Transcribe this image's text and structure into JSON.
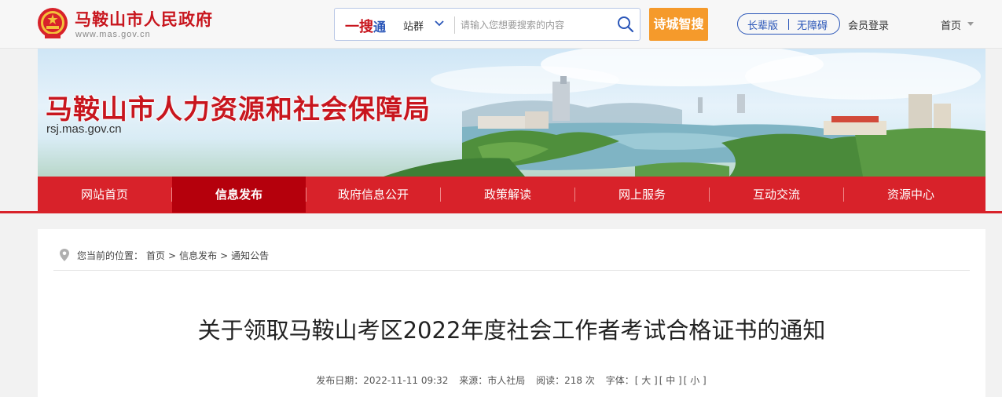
{
  "header": {
    "site_name": "马鞍山市人民政府",
    "site_url": "www.mas.gov.cn",
    "search": {
      "brand_part1": "一搜",
      "brand_part2": "通",
      "scope_label": "站群",
      "placeholder": "请输入您想要搜索的内容"
    },
    "smart_search_label": "诗城智搜",
    "accessibility": {
      "elder_label": "长辈版",
      "barrier_free_label": "无障碍"
    },
    "login_label": "会员登录",
    "home_label": "首页"
  },
  "banner": {
    "title": "马鞍山市人力资源和社会保障局",
    "url": "rsj.mas.gov.cn"
  },
  "nav": {
    "items": [
      {
        "label": "网站首页"
      },
      {
        "label": "信息发布"
      },
      {
        "label": "政府信息公开"
      },
      {
        "label": "政策解读"
      },
      {
        "label": "网上服务"
      },
      {
        "label": "互动交流"
      },
      {
        "label": "资源中心"
      }
    ],
    "active_index": 1
  },
  "breadcrumb": {
    "prefix": "您当前的位置：",
    "items": [
      "首页",
      "信息发布",
      "通知公告"
    ],
    "separator": ">"
  },
  "article": {
    "title": "关于领取马鞍山考区2022年度社会工作者考试合格证书的通知",
    "publish_label": "发布日期：",
    "publish_date": "2022-11-11 09:32",
    "source_label": "来源：",
    "source": "市人社局",
    "views_label": "阅读：",
    "views_value": "218 次",
    "font_label": "字体：",
    "font_large": "[ 大 ]",
    "font_medium": "[ 中 ]",
    "font_small": "[ 小 ]"
  },
  "colors": {
    "brand_red": "#c8161e",
    "nav_red": "#d8222a",
    "nav_active": "#b5000c",
    "accent_blue": "#2a56b8",
    "smart_orange": "#f59a2b"
  }
}
